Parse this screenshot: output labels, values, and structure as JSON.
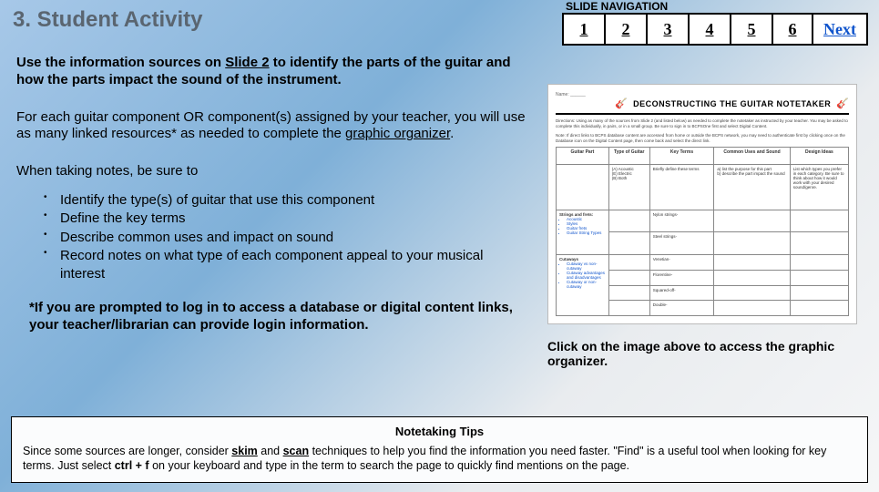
{
  "title": "3. Student Activity",
  "nav": {
    "label": "SLIDE NAVIGATION",
    "items": [
      "1",
      "2",
      "3",
      "4",
      "5",
      "6"
    ],
    "next": "Next"
  },
  "intro": {
    "pre": "Use the information sources on ",
    "link": "Slide 2",
    "post": " to identify the parts of the guitar and how the parts impact the sound of the instrument."
  },
  "para2": {
    "pre": "For each guitar component OR component(s) assigned by your teacher, you will use as many linked resources* as needed to complete the ",
    "link": "graphic organizer",
    "post": "."
  },
  "notes_lead": "When taking notes, be sure to",
  "bullets": [
    "Identify the type(s) of guitar that use this component",
    "Define the key terms",
    "Describe common uses and impact on sound",
    "Record notes on what type of each component appeal to your musical interest"
  ],
  "footnote": "*If you are prompted to log in to access a database or digital content links, your teacher/librarian can provide login information.",
  "caption": "Click on the image above to access the graphic organizer.",
  "tips": {
    "title": "Notetaking Tips",
    "pre": "Since some sources are longer, consider ",
    "skim": "skim",
    "mid1": " and ",
    "scan": "scan",
    "mid2": " techniques to help you find the information you need faster. \"Find\" is a useful tool when looking for key terms. Just select ",
    "ctrl": "ctrl + f",
    "post": " on your keyboard and type in the term to search the page to quickly find mentions on the page."
  },
  "thumb": {
    "title": "DECONSTRUCTING THE GUITAR NOTETAKER",
    "directions": "Directions: Using as many of the sources from Slide 2 (and listed below) as needed to complete the notetaker as instructed by your teacher. You may be asked to complete this individually, in pairs, or in a small group. Be sure to sign in to BCPSOne first and select Digital Content.",
    "note": "Note: If direct links to BCPS database content are accessed from home or outside the BCPS network, you may need to authenticate first by clicking once on the Database icon on the Digital Content page, then come back and select the direct link.",
    "headers": [
      "Guitar Part",
      "Type of Guitar",
      "Key Terms",
      "Common Uses and Sound",
      "Design Ideas"
    ],
    "row1": {
      "c1": "",
      "c2": "(A) Acoustic\n(E) Electric\n(B) Both",
      "c3": "Briefly define these terms",
      "c4": "a) list the purpose for this part\nb) describe the part impact the sound",
      "c5": "List which types you prefer in each category. Be sure to think about how it would work with your desired sound/genre."
    },
    "parts": {
      "p1": {
        "label": "Strings and frets:",
        "items": [
          "Acoustic",
          "Styles",
          "Guitar frets",
          "Guitar String Types"
        ],
        "k1": "Nylon strings-",
        "k2": "Steel strings-"
      },
      "p2": {
        "label": "Cutaways",
        "items": [
          "Cutaway vs non-cutaway",
          "Cutaway advantages and disadvantages",
          "Cutaway or non-cutaway"
        ],
        "k1": "Venetian-",
        "k2": "Florentine-",
        "k3": "Squared-off-",
        "k4": "Double-"
      }
    }
  }
}
